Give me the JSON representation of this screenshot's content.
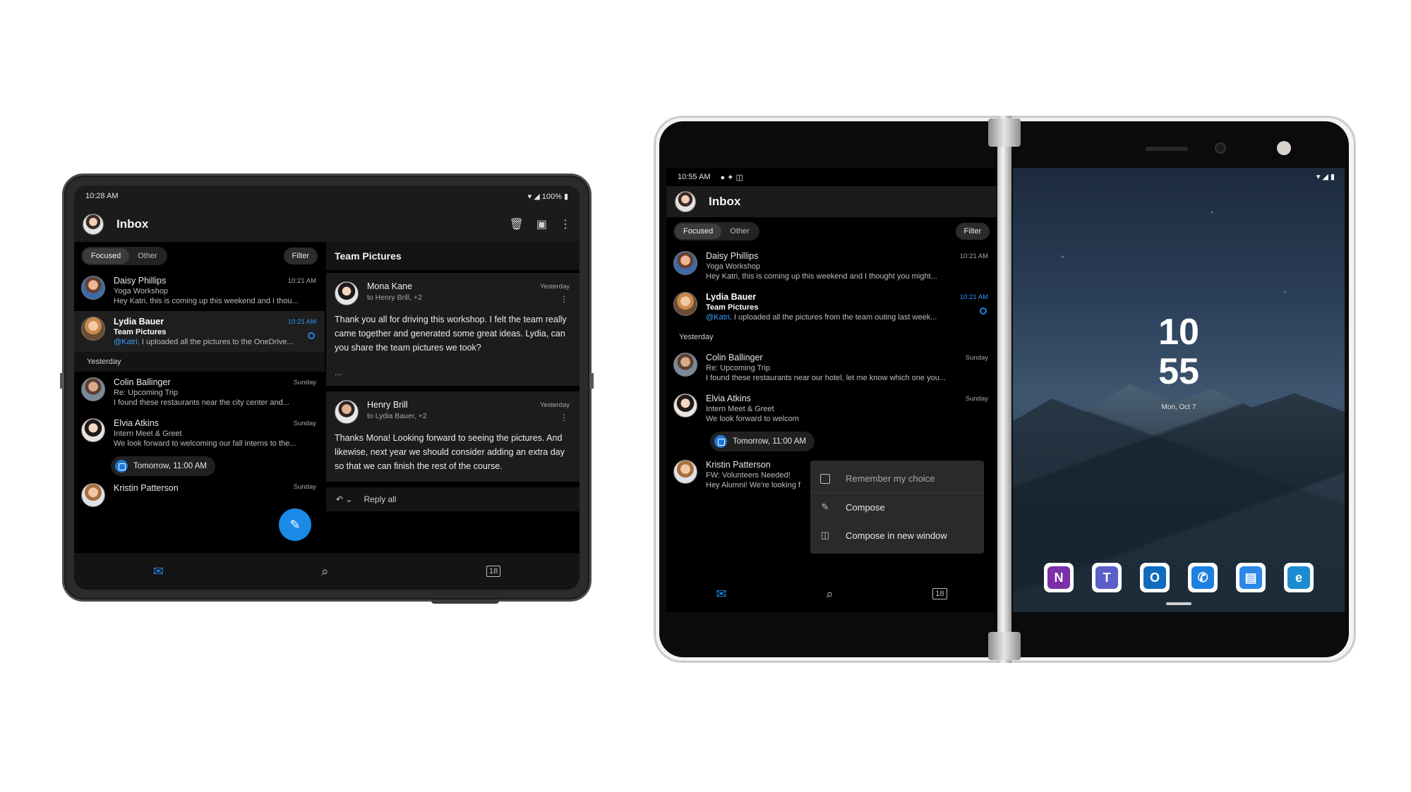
{
  "left_device": {
    "status": {
      "time": "10:28 AM",
      "battery": "100%"
    },
    "appbar": {
      "title": "Inbox"
    },
    "pivot": {
      "focused": "Focused",
      "other": "Other",
      "filter": "Filter"
    },
    "mails": [
      {
        "from": "Daisy Phillips",
        "subject": "Yoga Workshop",
        "preview": "Hey Katri, this is coming up this weekend and I thou...",
        "time": "10:21 AM"
      },
      {
        "from": "Lydia Bauer",
        "subject": "Team Pictures",
        "mention": "@Katri,",
        "preview": " I uploaded all the pictures to the OneDrive...",
        "time": "10:21 AM"
      }
    ],
    "section": "Yesterday",
    "mails_yesterday": [
      {
        "from": "Colin Ballinger",
        "subject": "Re: Upcoming Trip",
        "preview": "I found these restaurants near the city center and...",
        "time": "Sunday"
      },
      {
        "from": "Elvia Atkins",
        "subject": "Intern Meet & Greet",
        "preview": "We look forward to welcoming our fall interns to the...",
        "time": "Sunday"
      }
    ],
    "event_chip": "Tomorrow, 11:00 AM",
    "partial_item": {
      "from": "Kristin Patterson",
      "time": "Sunday"
    },
    "reading": {
      "title": "Team Pictures",
      "messages": [
        {
          "from": "Mona Kane",
          "to": "to Henry Brill, +2",
          "time": "Yesterday",
          "text": "Thank you all for driving this workshop. I felt the team really came together and generated some great ideas. Lydia, can you share the team pictures we took?",
          "ellipsis": "..."
        },
        {
          "from": "Henry Brill",
          "to": "to Lydia Bauer, +2",
          "time": "Yesterday",
          "text": "Thanks Mona! Looking forward to seeing the pictures. And likewise, next year we should consider adding an extra day so that we can finish the rest of the course."
        }
      ],
      "reply_all": "Reply all"
    },
    "calendar_day": "18"
  },
  "right_device": {
    "status": {
      "time": "10:55 AM"
    },
    "appbar": {
      "title": "Inbox"
    },
    "pivot": {
      "focused": "Focused",
      "other": "Other",
      "filter": "Filter"
    },
    "mails": [
      {
        "from": "Daisy Phillips",
        "subject": "Yoga Workshop",
        "preview": "Hey Katri, this is coming up this weekend and I thought you might...",
        "time": "10:21 AM"
      },
      {
        "from": "Lydia Bauer",
        "subject": "Team Pictures",
        "mention": "@Katri,",
        "preview": " I uploaded all the pictures from the team outing last week...",
        "time": "10:21 AM"
      }
    ],
    "section": "Yesterday",
    "mails_yesterday": [
      {
        "from": "Colin Ballinger",
        "subject": "Re: Upcoming Trip",
        "preview": "I found these restaurants near our hotel, let me know which one you...",
        "time": "Sunday"
      },
      {
        "from": "Elvia Atkins",
        "subject": "Intern Meet & Greet",
        "preview": "We look forward to welcom",
        "time": "Sunday"
      },
      {
        "from": "Kristin Patterson",
        "subject": "FW: Volunteers Needed!",
        "preview": "Hey Alumni! We're looking f",
        "time": ""
      }
    ],
    "event_chip": "Tomorrow, 11:00 AM",
    "context_menu": {
      "remember": "Remember my choice",
      "compose": "Compose",
      "compose_new_window": "Compose in new window"
    },
    "calendar_day": "18",
    "lock": {
      "hour": "10",
      "minute": "55",
      "date": "Mon, Oct 7"
    },
    "dock_apps": [
      {
        "name": "onenote-icon",
        "glyph": "N",
        "color": "#7b2fa8"
      },
      {
        "name": "teams-icon",
        "glyph": "T",
        "color": "#5b5fc7"
      },
      {
        "name": "outlook-icon",
        "glyph": "O",
        "color": "#0f6cbd"
      },
      {
        "name": "phone-icon",
        "glyph": "✆",
        "color": "#1d7fe0"
      },
      {
        "name": "messages-icon",
        "glyph": "▤",
        "color": "#2b88e8"
      },
      {
        "name": "edge-icon",
        "glyph": "e",
        "color": "#1d8bd0"
      }
    ]
  }
}
